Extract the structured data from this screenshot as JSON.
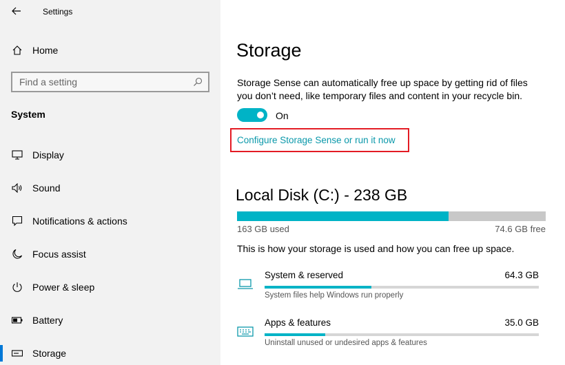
{
  "window": {
    "title": "Settings"
  },
  "sidebar": {
    "home_label": "Home",
    "search_placeholder": "Find a setting",
    "section_label": "System",
    "items": [
      {
        "label": "Display",
        "icon": "monitor-icon"
      },
      {
        "label": "Sound",
        "icon": "speaker-icon"
      },
      {
        "label": "Notifications & actions",
        "icon": "notification-icon"
      },
      {
        "label": "Focus assist",
        "icon": "moon-icon"
      },
      {
        "label": "Power & sleep",
        "icon": "power-icon"
      },
      {
        "label": "Battery",
        "icon": "battery-icon"
      },
      {
        "label": "Storage",
        "icon": "storage-icon",
        "active": true
      }
    ]
  },
  "main": {
    "title": "Storage",
    "description": "Storage Sense can automatically free up space by getting rid of files you don’t need, like temporary files and content in your recycle bin.",
    "storage_sense": {
      "state_label": "On",
      "enabled": true
    },
    "configure_link": "Configure Storage Sense or run it now",
    "disk": {
      "title": "Local Disk (C:) - 238 GB",
      "used_label": "163 GB used",
      "free_label": "74.6 GB free",
      "used_fraction": 0.685
    },
    "storage_intro": "This is how your storage is used and how you can free up space.",
    "categories": [
      {
        "name": "System & reserved",
        "size": "64.3 GB",
        "description": "System files help Windows run properly",
        "fraction": 0.39,
        "icon": "laptop-icon"
      },
      {
        "name": "Apps & features",
        "size": "35.0 GB",
        "description": "Uninstall unused or undesired apps & features",
        "fraction": 0.22,
        "icon": "keyboard-icon"
      }
    ]
  },
  "colors": {
    "accent": "#00b3c6",
    "link": "#0a98aa",
    "highlight_border": "#e31b23",
    "sidebar_bg": "#f2f2f2"
  }
}
